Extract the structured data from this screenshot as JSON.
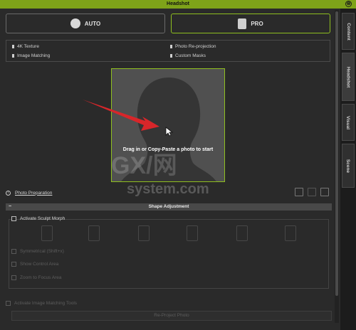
{
  "window": {
    "title": "Headshot",
    "close_glyph": "⊗"
  },
  "right_tabs": [
    {
      "label": "Content",
      "active": false
    },
    {
      "label": "Headshot",
      "active": true
    },
    {
      "label": "Visual",
      "active": false
    },
    {
      "label": "Scene",
      "active": false
    }
  ],
  "modes": {
    "auto": {
      "label": "AUTO",
      "icon": "auto-head-icon"
    },
    "pro": {
      "label": "PRO",
      "icon": "pro-head-icon",
      "selected": true
    }
  },
  "features": [
    "4K Texture",
    "Photo Re-projection",
    "Image Matching",
    "Custom Masks"
  ],
  "photo": {
    "prompt": "Drag in or Copy-Paste a photo to start"
  },
  "photo_prep": {
    "info_glyph": "i",
    "label": "Photo Preparation"
  },
  "shape_adjustment": {
    "title": "Shape Adjustment",
    "collapse_glyph": "−",
    "activate_label": "Activate Sculpt Morph",
    "options": [
      "Symmetrical (Shift+x)",
      "Show Control Area",
      "Zoom to Focus Area"
    ]
  },
  "image_matching": {
    "activate_label": "Activate Image Matching Tools",
    "reproject_label": "Re-Project Photo"
  },
  "watermark": {
    "text_top": "GX/网",
    "text_bottom": "system.com"
  },
  "colors": {
    "accent": "#8fbf1f",
    "title_bar": "#7ea319",
    "arrow": "#d8262a"
  }
}
